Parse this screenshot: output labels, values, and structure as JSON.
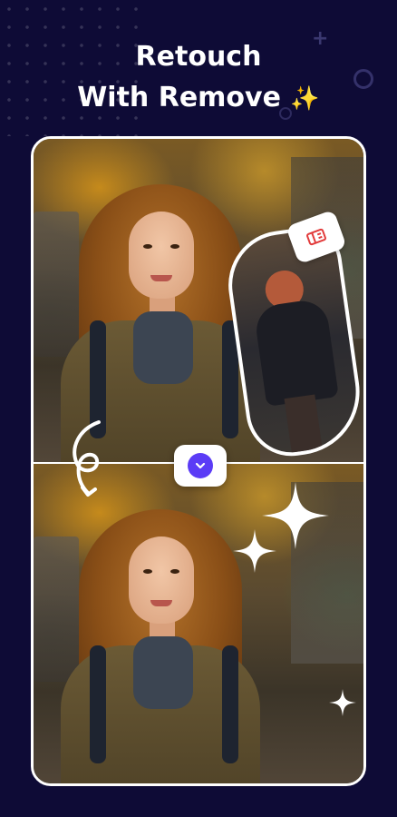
{
  "header": {
    "title_line1": "Retouch",
    "title_line2": "With Remove",
    "title_emoji": "✨"
  },
  "colors": {
    "background": "#0e0b36",
    "accent": "#5b3cf6",
    "frame_border": "#ffffff"
  },
  "icons": {
    "eraser": "eraser-icon",
    "compare_toggle": "chevron-down-icon",
    "curved_arrow": "curved-arrow-icon",
    "sparkle": "sparkle-icon"
  }
}
